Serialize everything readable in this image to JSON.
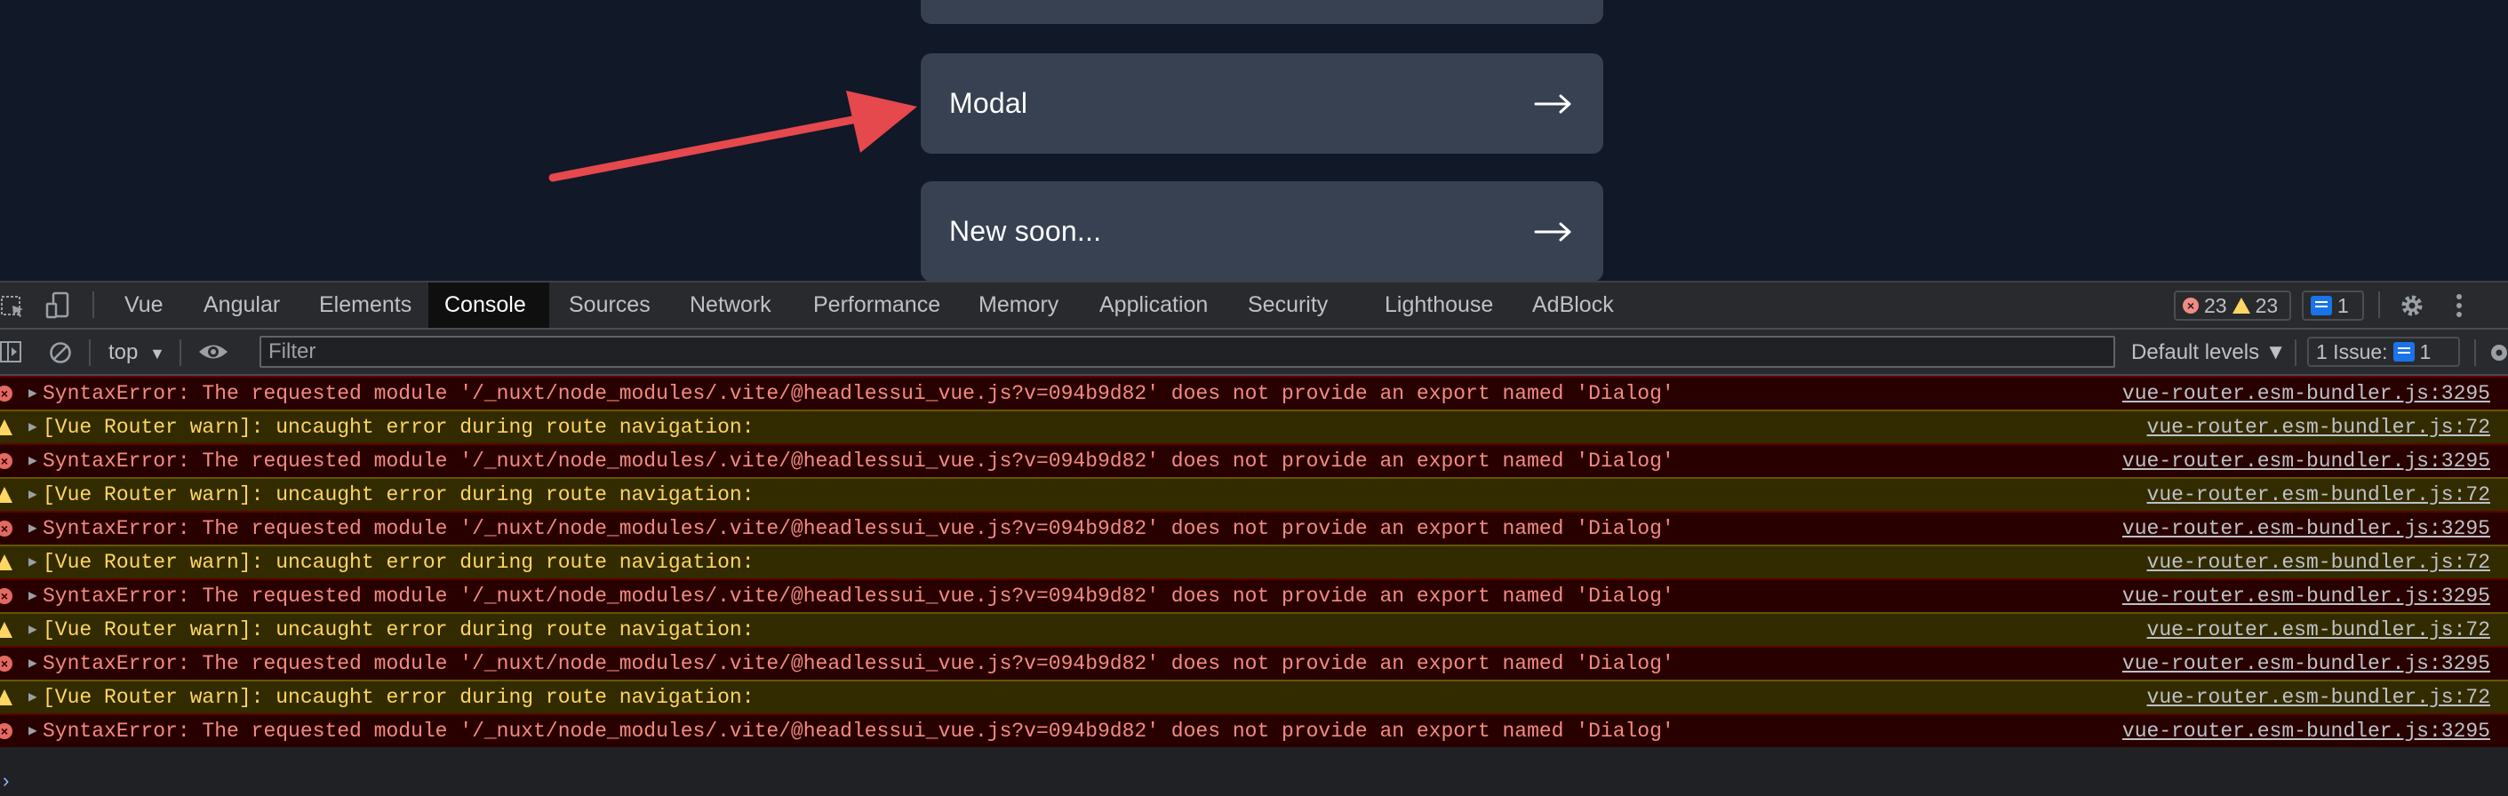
{
  "page": {
    "cards": [
      {
        "label": ""
      },
      {
        "label": "Modal",
        "arrow": "→"
      },
      {
        "label": "New soon...",
        "arrow": "→"
      }
    ],
    "colors": {
      "background": "#111827",
      "card": "#374151",
      "annotation_arrow": "#e5484d"
    }
  },
  "devtools": {
    "tabs": [
      "Vue",
      "Angular",
      "Elements",
      "Console",
      "Sources",
      "Network",
      "Performance",
      "Memory",
      "Application",
      "Security",
      "Lighthouse",
      "AdBlock"
    ],
    "active_tab": "Console",
    "counts": {
      "errors": "23",
      "warnings": "23",
      "messages": "1"
    },
    "toolbar": {
      "context": "top",
      "filter_placeholder": "Filter",
      "levels": "Default levels ▼",
      "issues_label": "1 Issue:",
      "issues_count": "1"
    },
    "rows": [
      {
        "level": "error",
        "message": "SyntaxError: The requested module '/_nuxt/node_modules/.vite/@headlessui_vue.js?v=094b9d82' does not provide an export named 'Dialog'",
        "source": "vue-router.esm-bundler.js:3295"
      },
      {
        "level": "warn",
        "message": "[Vue Router warn]: uncaught error during route navigation:",
        "source": "vue-router.esm-bundler.js:72"
      },
      {
        "level": "error",
        "message": "SyntaxError: The requested module '/_nuxt/node_modules/.vite/@headlessui_vue.js?v=094b9d82' does not provide an export named 'Dialog'",
        "source": "vue-router.esm-bundler.js:3295"
      },
      {
        "level": "warn",
        "message": "[Vue Router warn]: uncaught error during route navigation:",
        "source": "vue-router.esm-bundler.js:72"
      },
      {
        "level": "error",
        "message": "SyntaxError: The requested module '/_nuxt/node_modules/.vite/@headlessui_vue.js?v=094b9d82' does not provide an export named 'Dialog'",
        "source": "vue-router.esm-bundler.js:3295"
      },
      {
        "level": "warn",
        "message": "[Vue Router warn]: uncaught error during route navigation:",
        "source": "vue-router.esm-bundler.js:72"
      },
      {
        "level": "error",
        "message": "SyntaxError: The requested module '/_nuxt/node_modules/.vite/@headlessui_vue.js?v=094b9d82' does not provide an export named 'Dialog'",
        "source": "vue-router.esm-bundler.js:3295"
      },
      {
        "level": "warn",
        "message": "[Vue Router warn]: uncaught error during route navigation:",
        "source": "vue-router.esm-bundler.js:72"
      },
      {
        "level": "error",
        "message": "SyntaxError: The requested module '/_nuxt/node_modules/.vite/@headlessui_vue.js?v=094b9d82' does not provide an export named 'Dialog'",
        "source": "vue-router.esm-bundler.js:3295"
      },
      {
        "level": "warn",
        "message": "[Vue Router warn]: uncaught error during route navigation:",
        "source": "vue-router.esm-bundler.js:72"
      },
      {
        "level": "error",
        "message": "SyntaxError: The requested module '/_nuxt/node_modules/.vite/@headlessui_vue.js?v=094b9d82' does not provide an export named 'Dialog'",
        "source": "vue-router.esm-bundler.js:3295"
      }
    ],
    "prompt": "›"
  }
}
